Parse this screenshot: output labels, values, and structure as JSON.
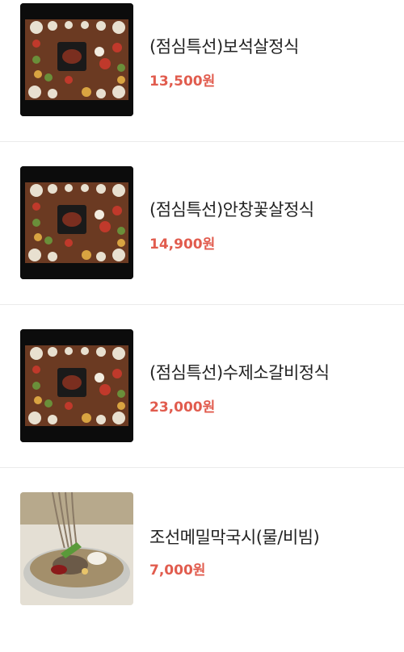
{
  "menu": {
    "items": [
      {
        "name": "(점심특선)보석살정식",
        "price": "13,500원",
        "image_icon": "hanjeongsik-table-photo"
      },
      {
        "name": "(점심특선)안창꽃살정식",
        "price": "14,900원",
        "image_icon": "hanjeongsik-table-photo"
      },
      {
        "name": "(점심특선)수제소갈비정식",
        "price": "23,000원",
        "image_icon": "hanjeongsik-table-photo"
      },
      {
        "name": "조선메밀막국시(물/비빔)",
        "price": "7,000원",
        "image_icon": "buckwheat-noodle-bowl-photo"
      }
    ]
  },
  "colors": {
    "price": "#e15c4e",
    "divider": "#ebebeb",
    "name": "#222222"
  }
}
